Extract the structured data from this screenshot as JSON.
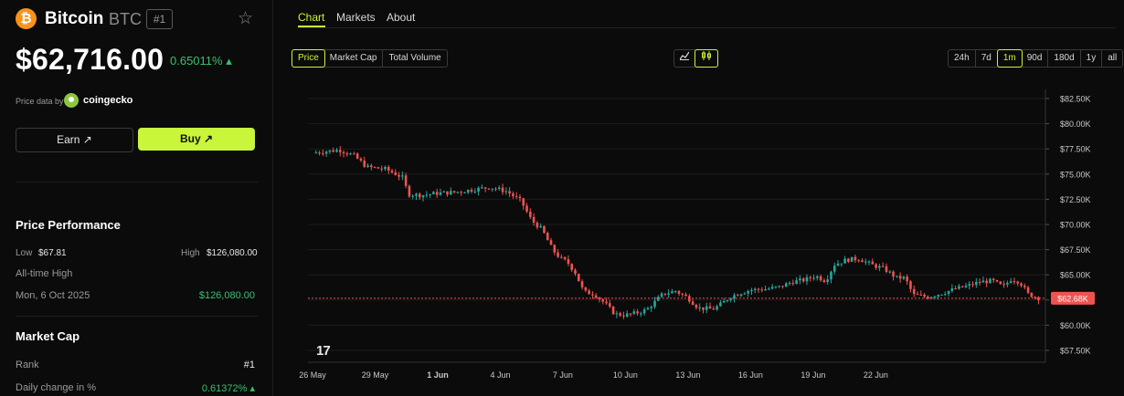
{
  "coin": {
    "logo_glyph": "₿",
    "name": "Bitcoin",
    "symbol": "BTC",
    "rank_badge": "#1",
    "star_icon": "☆"
  },
  "price": {
    "value": "$62,716.00",
    "change": "0.65011% ▴"
  },
  "price_data": {
    "label": "Price data by",
    "provider": "coingecko"
  },
  "buttons": {
    "earn": "Earn ↗",
    "buy": "Buy ↗"
  },
  "performance": {
    "title": "Price Performance",
    "low_label": "Low",
    "low_value": "$67.81",
    "high_label": "High",
    "high_value": "$126,080.00",
    "ath_label": "All-time High",
    "ath_date": "Mon, 6 Oct 2025",
    "ath_value": "$126,080.00"
  },
  "market_cap": {
    "title": "Market Cap",
    "rank_label": "Rank",
    "rank_value": "#1",
    "daily_label": "Daily change in %",
    "daily_value": "0.61372% ▴"
  },
  "tabs": [
    "Chart",
    "Markets",
    "About"
  ],
  "metric_toggle": [
    "Price",
    "Market Cap",
    "Total Volume"
  ],
  "chart_style_icons": [
    "line-chart-icon",
    "candlestick-icon"
  ],
  "ranges": [
    "24h",
    "7d",
    "1m",
    "90d",
    "180d",
    "1y",
    "all"
  ],
  "colors": {
    "accent": "#c9f53a",
    "up": "#26a69a",
    "down": "#ef5350",
    "positive_text": "#38c172"
  },
  "chart_data": {
    "type": "candlestick",
    "y_ticks": [
      "$82.50K",
      "$80.00K",
      "$77.50K",
      "$75.00K",
      "$72.50K",
      "$70.00K",
      "$67.50K",
      "$65.00K",
      "$62.50K",
      "$60.00K",
      "$57.50K"
    ],
    "x_ticks": [
      "26 May",
      "29 May",
      "1 Jun",
      "4 Jun",
      "7 Jun",
      "10 Jun",
      "13 Jun",
      "16 Jun",
      "19 Jun",
      "22 Jun"
    ],
    "ylim": [
      56000,
      83500
    ],
    "current_price_label": "$62.68K",
    "current_price": 62680,
    "close_path": [
      [
        0,
        77100
      ],
      [
        1.3,
        77400
      ],
      [
        2.0,
        76800
      ],
      [
        2.6,
        75700
      ],
      [
        3.5,
        75500
      ],
      [
        4.3,
        74700
      ],
      [
        4.6,
        73000
      ],
      [
        5.2,
        72900
      ],
      [
        6.0,
        73100
      ],
      [
        6.8,
        73200
      ],
      [
        7.5,
        73400
      ],
      [
        8.5,
        73700
      ],
      [
        9.3,
        73300
      ],
      [
        10.0,
        72300
      ],
      [
        10.5,
        70400
      ],
      [
        11.0,
        69500
      ],
      [
        11.5,
        67500
      ],
      [
        11.9,
        66600
      ],
      [
        12.2,
        66300
      ],
      [
        12.6,
        65200
      ],
      [
        13.0,
        63300
      ],
      [
        13.5,
        63100
      ],
      [
        14.0,
        62200
      ],
      [
        14.5,
        61100
      ],
      [
        15.0,
        61000
      ],
      [
        15.5,
        61200
      ],
      [
        16.0,
        61500
      ],
      [
        16.3,
        62100
      ],
      [
        16.8,
        63100
      ],
      [
        17.4,
        63400
      ],
      [
        18.0,
        62700
      ],
      [
        18.5,
        61700
      ],
      [
        19.2,
        61600
      ],
      [
        19.6,
        62100
      ],
      [
        20.0,
        62800
      ],
      [
        20.5,
        63200
      ],
      [
        21.0,
        63500
      ],
      [
        21.8,
        63600
      ],
      [
        22.4,
        63800
      ],
      [
        23.0,
        64300
      ],
      [
        23.6,
        64500
      ],
      [
        24.1,
        64900
      ],
      [
        24.6,
        64400
      ],
      [
        25.0,
        66000
      ],
      [
        25.6,
        66500
      ],
      [
        26.2,
        66600
      ],
      [
        26.8,
        66000
      ],
      [
        27.4,
        65600
      ],
      [
        28.0,
        64700
      ],
      [
        28.4,
        64700
      ],
      [
        28.8,
        63000
      ],
      [
        29.5,
        62800
      ],
      [
        30.2,
        63200
      ],
      [
        30.8,
        63600
      ],
      [
        31.4,
        63900
      ],
      [
        32.0,
        64300
      ],
      [
        32.6,
        64400
      ],
      [
        33.1,
        63800
      ],
      [
        33.5,
        64600
      ],
      [
        33.9,
        64300
      ],
      [
        34.3,
        63100
      ],
      [
        34.8,
        62700
      ]
    ]
  }
}
